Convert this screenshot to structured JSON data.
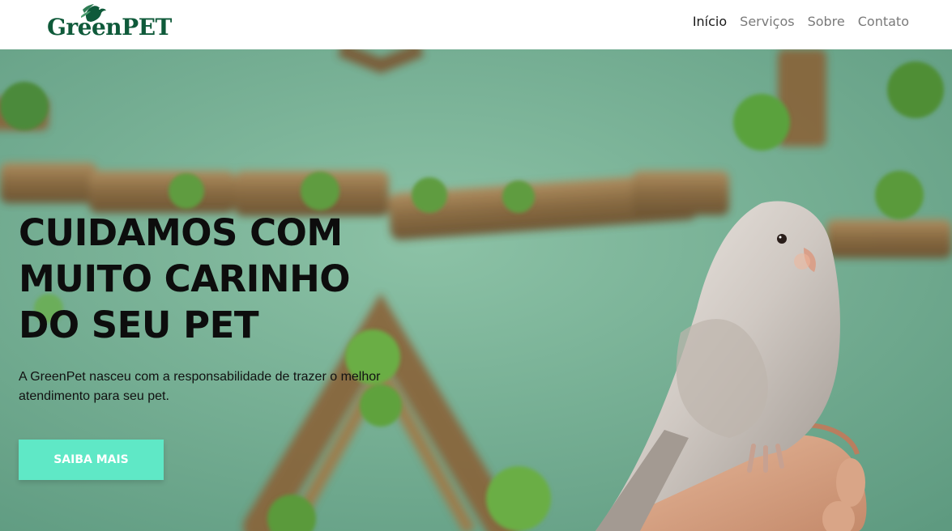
{
  "brand": {
    "name": "GreenPET"
  },
  "nav": {
    "items": [
      {
        "label": "Início",
        "active": true
      },
      {
        "label": "Serviços",
        "active": false
      },
      {
        "label": "Sobre",
        "active": false
      },
      {
        "label": "Contato",
        "active": false
      }
    ]
  },
  "hero": {
    "title_lines": [
      "CUIDAMOS COM",
      "MUITO CARINHO",
      "DO SEU PET"
    ],
    "description": "A GreenPet nasceu com a responsabilidade de trazer o melhor atendimento para seu pet.",
    "cta_label": "SAIBA MAIS",
    "background_image": "cockatiel perched on hand, green wall with bamboo planters"
  },
  "colors": {
    "logo_green": "#0f5a3a",
    "cta": "#5fe8c6",
    "nav_active": "#1a1a1a",
    "nav_inactive": "#7a7a7a"
  }
}
